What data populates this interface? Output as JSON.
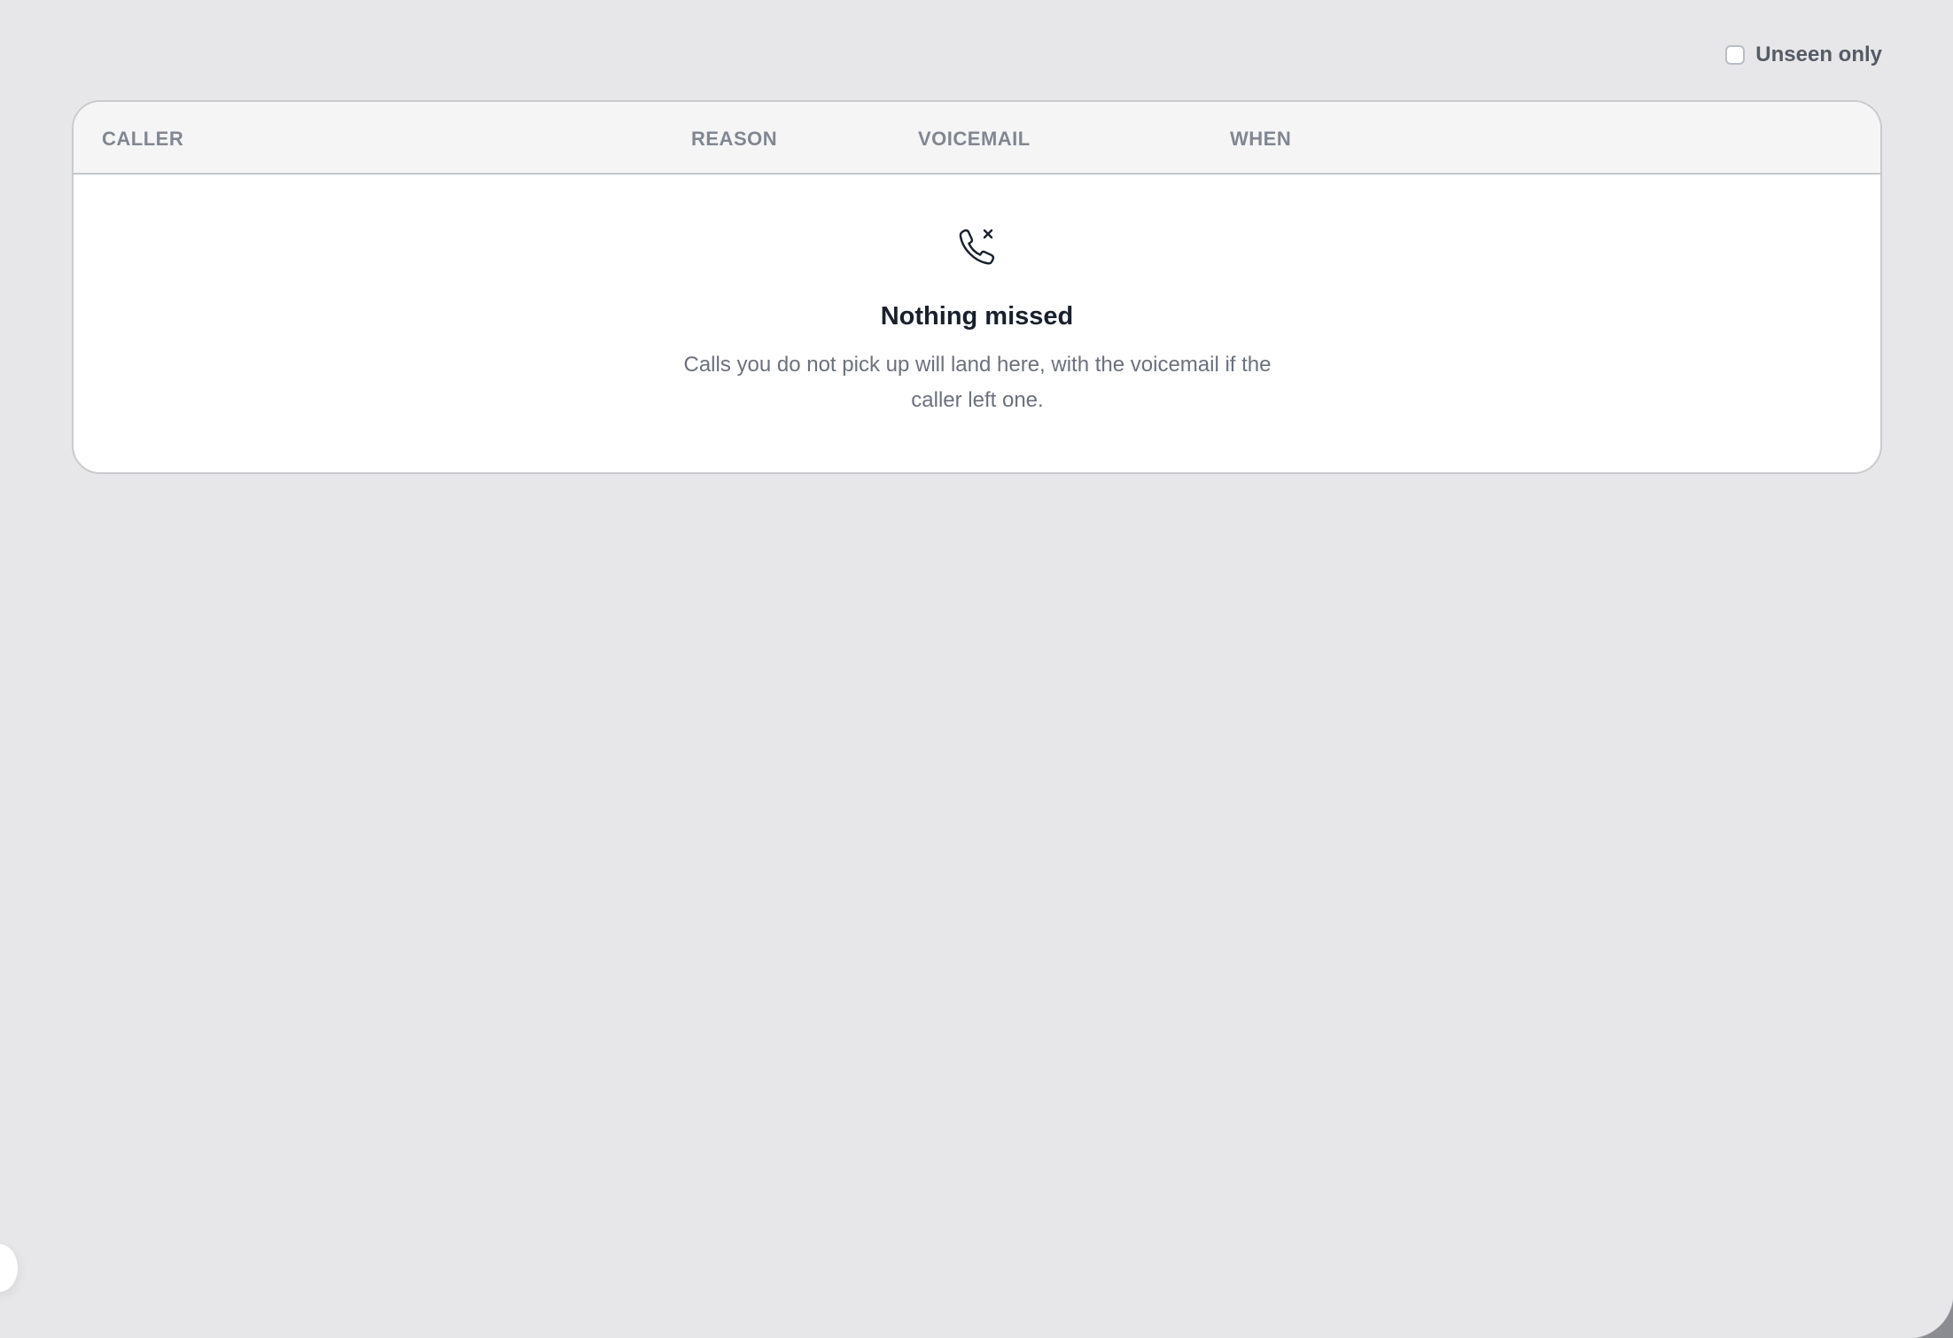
{
  "filter": {
    "unseen_only_label": "Unseen only",
    "unseen_only_checked": false
  },
  "table": {
    "columns": [
      "CALLER",
      "REASON",
      "VOICEMAIL",
      "WHEN"
    ],
    "rows": []
  },
  "empty_state": {
    "icon": "phone-missed-icon",
    "title": "Nothing missed",
    "description": "Calls you do not pick up will land here, with the voicemail if the caller left one."
  },
  "colors": {
    "background": "#e7e7e9",
    "panel": "#ffffff",
    "header_bg": "#f5f5f6",
    "title_text": "#18202c",
    "muted_text": "#6b717c",
    "column_text": "#818791"
  }
}
